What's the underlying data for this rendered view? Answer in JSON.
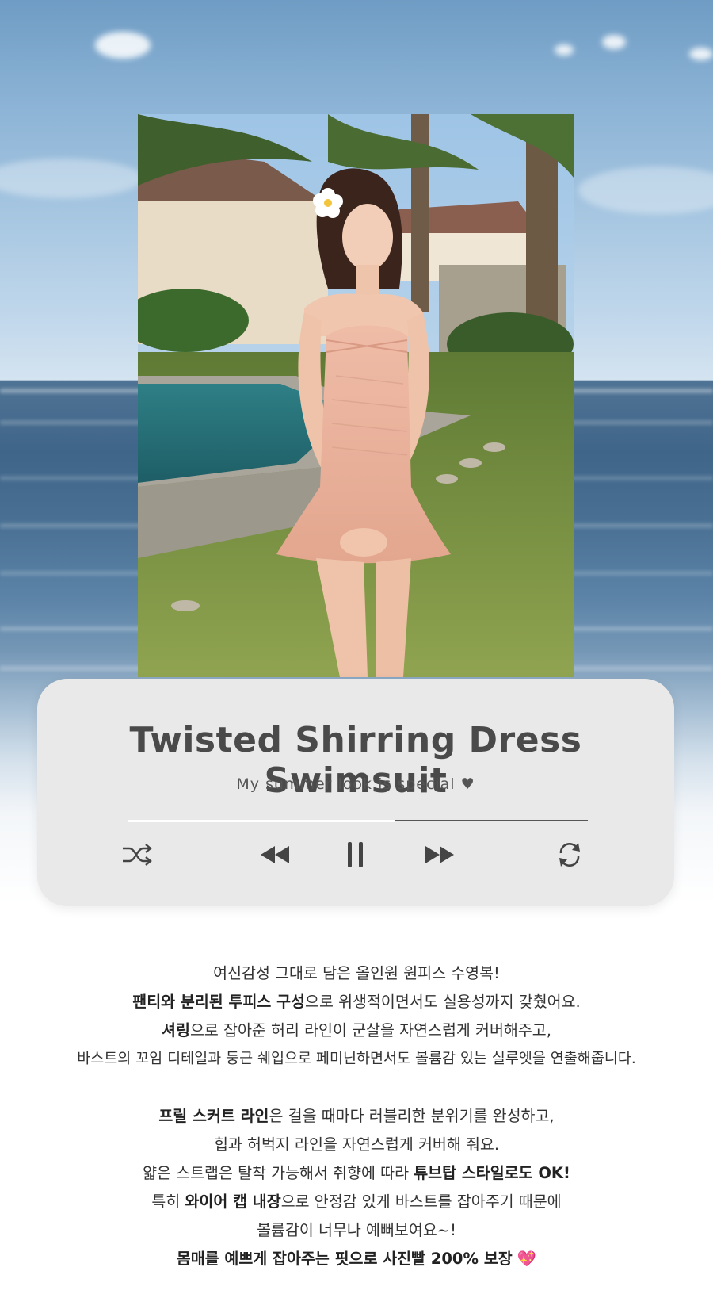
{
  "player": {
    "title": "Twisted Shirring Dress Swimsuit",
    "subtitle": "My summer look is special ♥",
    "progress": 0.58,
    "controls": [
      "shuffle-icon",
      "rewind-icon",
      "pause-icon",
      "fast-forward-icon",
      "repeat-icon"
    ]
  },
  "description": {
    "p1_line1": "여신감성 그대로 담은 올인원 원피스 수영복!",
    "p1_line2_bold": "팬티와 분리된 투피스 구성",
    "p1_line2_rest": "으로 위생적이면서도 실용성까지 갖췄어요.",
    "p1_line3_bold": "셔링",
    "p1_line3_rest": "으로 잡아준 허리 라인이 군살을 자연스럽게 커버해주고,",
    "p1_line4": "바스트의 꼬임 디테일과 둥근 쉐입으로 페미닌하면서도 볼륨감 있는 실루엣을 연출해줍니다.",
    "p2_line1_bold": "프릴 스커트 라인",
    "p2_line1_rest": "은 걸을 때마다 러블리한 분위기를 완성하고,",
    "p2_line2": "힙과 허벅지 라인을 자연스럽게 커버해 줘요.",
    "p2_line3_pre": "얇은 스트랩은 탈착 가능해서 취향에 따라 ",
    "p2_line3_bold": "튜브탑 스타일로도 OK!",
    "p2_line4_pre": "특히 ",
    "p2_line4_bold": "와이어 캡 내장",
    "p2_line4_rest": "으로 안정감 있게 바스트를 잡아주기 때문에",
    "p2_line5": "볼륨감이 너무나 예뻐보여요~!",
    "p2_line6_bold": "몸매를 예쁘게 잡아주는 핏으로 사진빨 200% 보장",
    "p2_line6_emoji": "💖"
  },
  "colors": {
    "card_bg": "#e9e9e9",
    "title_text": "#4a4a4a",
    "dress_pink": "#eab29c",
    "sky": "#a9c8e2",
    "sea": "#3f6589"
  }
}
